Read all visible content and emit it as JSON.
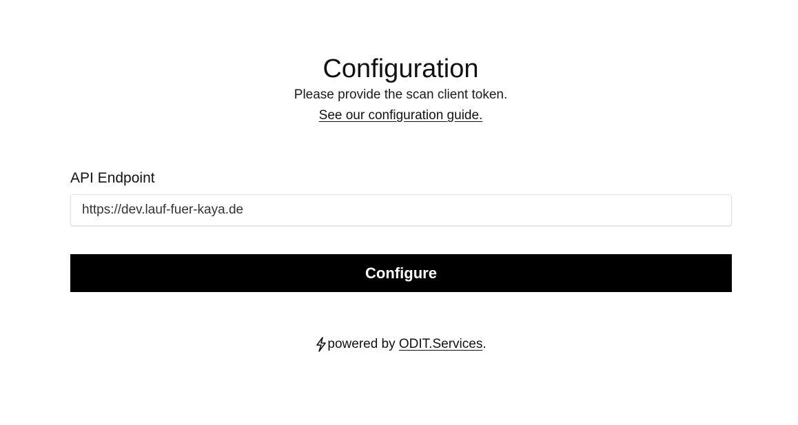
{
  "header": {
    "title": "Configuration",
    "subtitle": "Please provide the scan client token.",
    "guide_link": "See our configuration guide."
  },
  "form": {
    "endpoint_label": "API Endpoint",
    "endpoint_value": "https://dev.lauf-fuer-kaya.de",
    "submit_label": "Configure"
  },
  "footer": {
    "icon": "lightning-bolt-icon",
    "prefix": "powered by ",
    "link": "ODIT.Services",
    "suffix": "."
  }
}
